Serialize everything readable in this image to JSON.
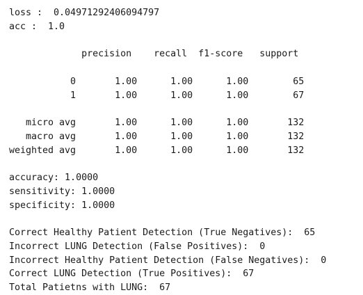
{
  "output_lines": [
    "loss :  0.04971292406094797",
    "acc :  1.0",
    "",
    "             precision    recall  f1-score   support",
    "",
    "           0       1.00      1.00      1.00        65",
    "           1       1.00      1.00      1.00        67",
    "",
    "   micro avg       1.00      1.00      1.00       132",
    "   macro avg       1.00      1.00      1.00       132",
    "weighted avg       1.00      1.00      1.00       132",
    "",
    "accuracy: 1.0000",
    "sensitivity: 1.0000",
    "specificity: 1.0000",
    "",
    "Correct Healthy Patient Detection (True Negatives):  65",
    "Incorrect LUNG Detection (False Positives):  0",
    "Incorrect Healthy Patient Detection (False Negatives):  0",
    "Correct LUNG Detection (True Positives):  67",
    "Total Patietns with LUNG:  67"
  ]
}
